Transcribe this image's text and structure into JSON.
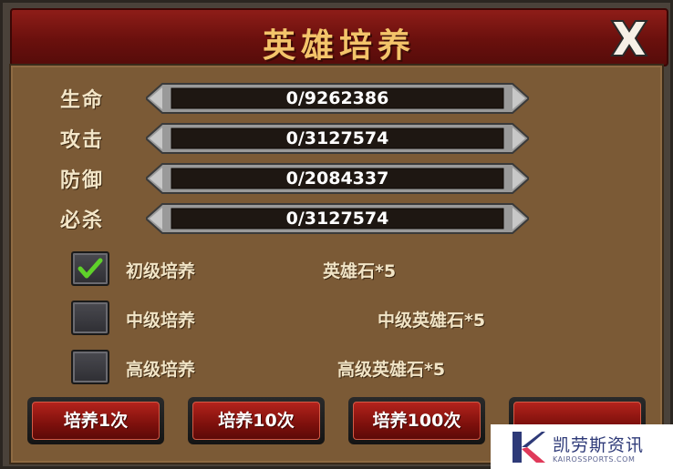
{
  "dialog": {
    "title": "英雄培养",
    "close_icon": "close-x-icon"
  },
  "stats": [
    {
      "label": "生命",
      "value": "0/9262386"
    },
    {
      "label": "攻击",
      "value": "0/3127574"
    },
    {
      "label": "防御",
      "value": "0/2084337"
    },
    {
      "label": "必杀",
      "value": "0/3127574"
    }
  ],
  "options": [
    {
      "label": "初级培养",
      "cost": "英雄石*5",
      "checked": true
    },
    {
      "label": "中级培养",
      "cost": "中级英雄石*5",
      "checked": false
    },
    {
      "label": "高级培养",
      "cost": "高级英雄石*5",
      "checked": false
    }
  ],
  "buttons": [
    {
      "label": "培养1次"
    },
    {
      "label": "培养10次"
    },
    {
      "label": "培养100次"
    },
    {
      "label": ""
    }
  ],
  "watermark": {
    "text": "凯劳斯资讯",
    "sub": "KAIROSSPORTS.COM"
  },
  "colors": {
    "header": "#7a1510",
    "panel": "#7b5a36",
    "title": "#f3c46a",
    "button": "#a01c16",
    "check": "#5fd12a"
  }
}
